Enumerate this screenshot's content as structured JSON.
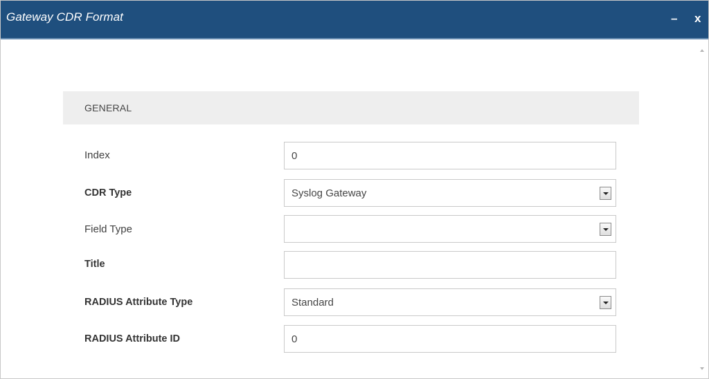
{
  "window": {
    "title": "Gateway CDR Format",
    "minimize_label": "–",
    "close_label": "x"
  },
  "section": {
    "title": "GENERAL"
  },
  "fields": [
    {
      "label": "Index",
      "value": "0",
      "type": "text",
      "bold": false
    },
    {
      "label": "CDR Type",
      "value": "Syslog Gateway",
      "type": "select",
      "bold": true
    },
    {
      "label": "Field Type",
      "value": "",
      "type": "select",
      "bold": false
    },
    {
      "label": "Title",
      "value": "",
      "type": "text",
      "bold": true
    },
    {
      "label": "RADIUS Attribute Type",
      "value": "Standard",
      "type": "select",
      "bold": true
    },
    {
      "label": "RADIUS Attribute ID",
      "value": "0",
      "type": "text",
      "bold": true
    }
  ],
  "colors": {
    "titlebar": "#1f4f7e",
    "section_bg": "#eeeeee",
    "field_border": "#c9c9c9"
  }
}
